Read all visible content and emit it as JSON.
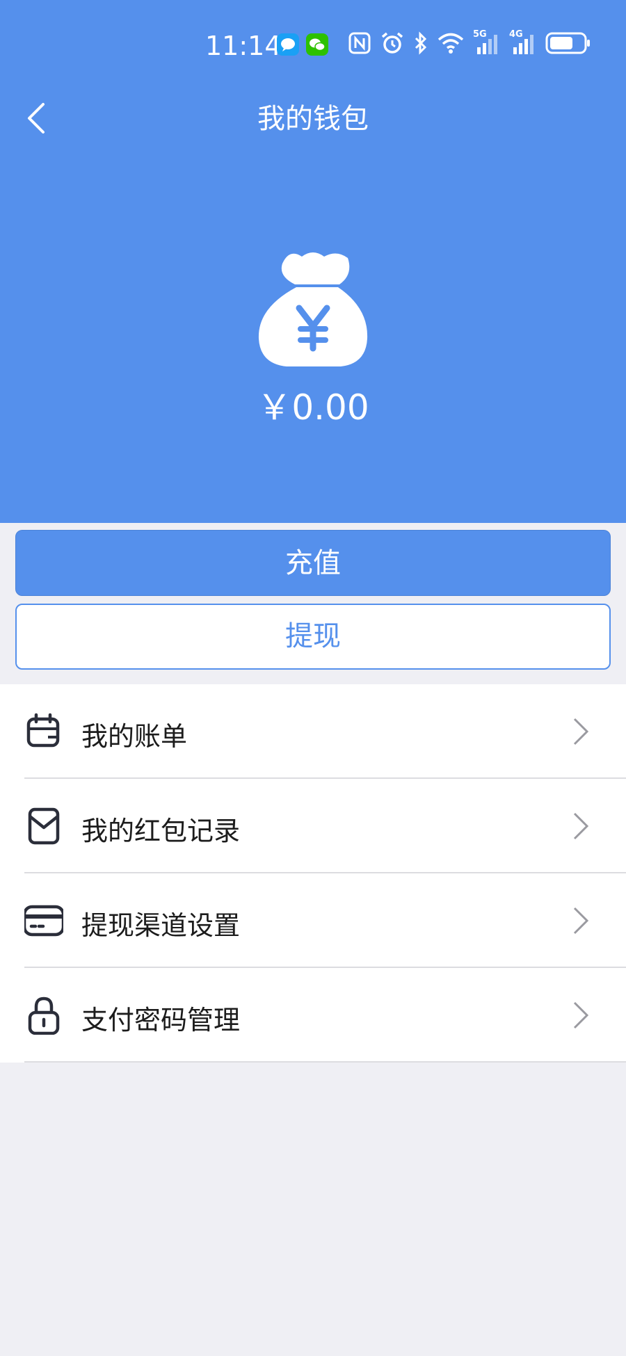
{
  "status_bar": {
    "time": "11:14",
    "net_5g": "5G",
    "net_4g": "4G"
  },
  "nav": {
    "title": "我的钱包"
  },
  "wallet": {
    "balance": "￥0.00"
  },
  "actions": {
    "recharge_label": "充值",
    "withdraw_label": "提现"
  },
  "menu": {
    "items": [
      {
        "label": "我的账单",
        "icon": "calendar-icon"
      },
      {
        "label": "我的红包记录",
        "icon": "red-envelope-icon"
      },
      {
        "label": "提现渠道设置",
        "icon": "bank-card-icon"
      },
      {
        "label": "支付密码管理",
        "icon": "lock-icon"
      }
    ]
  },
  "colors": {
    "primary": "#5590ec",
    "background": "#efeff4",
    "text": "#1c1c1c"
  }
}
